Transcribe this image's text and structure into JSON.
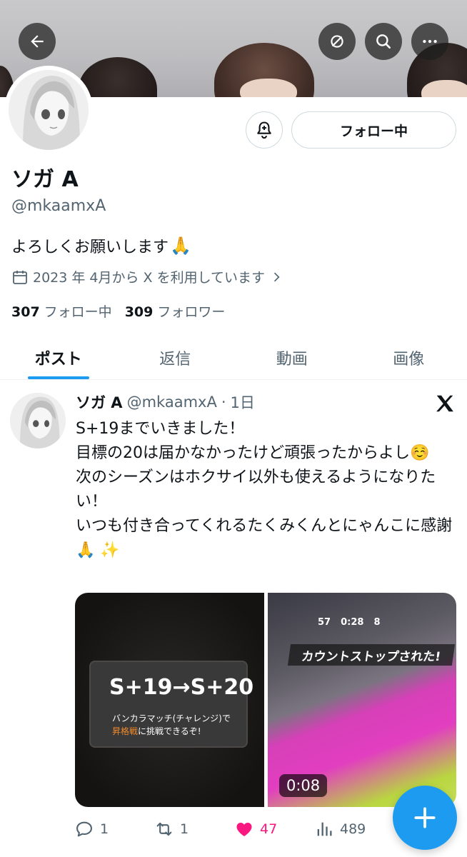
{
  "profile": {
    "name": "ソガ A",
    "handle": "@mkaamxA",
    "bio": "よろしくお願いします",
    "bio_emoji": "🙏",
    "joined": "2023 年 4月から X を利用しています",
    "following_count": "307",
    "following_label": "フォロー中",
    "followers_count": "309",
    "followers_label": "フォロワー",
    "follow_button": "フォロー中"
  },
  "tabs": [
    {
      "label": "ポスト",
      "active": true
    },
    {
      "label": "返信",
      "active": false
    },
    {
      "label": "動画",
      "active": false
    },
    {
      "label": "画像",
      "active": false
    }
  ],
  "post": {
    "name": "ソガ A",
    "handle": "@mkaamxA",
    "separator": "·",
    "time": "1日",
    "text": "S+19までいきました！\n目標の20は届かなかったけど頑張ったからよし☺️\n次のシーズンはホクサイ以外も使えるようになりたい！\nいつも付き合ってくれるたくみくんとにゃんこに感謝🙏 ✨",
    "media_left": {
      "rank_text": "S+19→S+20",
      "line1": "バンカラマッチ(チャレンジ)で",
      "line2_highlight": "昇格戦",
      "line2_rest": "に挑戦できるぞ!"
    },
    "media_right": {
      "banner": "カウントストップされた!",
      "hud_time": "0:28",
      "hud_left": "57",
      "hud_right": "8",
      "duration": "0:08"
    },
    "replies": "1",
    "reposts": "1",
    "likes": "47",
    "views": "489"
  },
  "colors": {
    "accent": "#1d9bf0",
    "like": "#f91880",
    "muted": "#536471"
  },
  "icons": [
    "back-arrow-icon",
    "no-sync-icon",
    "search-icon",
    "more-icon",
    "bell-plus-icon",
    "calendar-icon",
    "chevron-right-icon",
    "x-logo-icon",
    "reply-icon",
    "repost-icon",
    "heart-icon",
    "views-icon",
    "plus-icon"
  ]
}
